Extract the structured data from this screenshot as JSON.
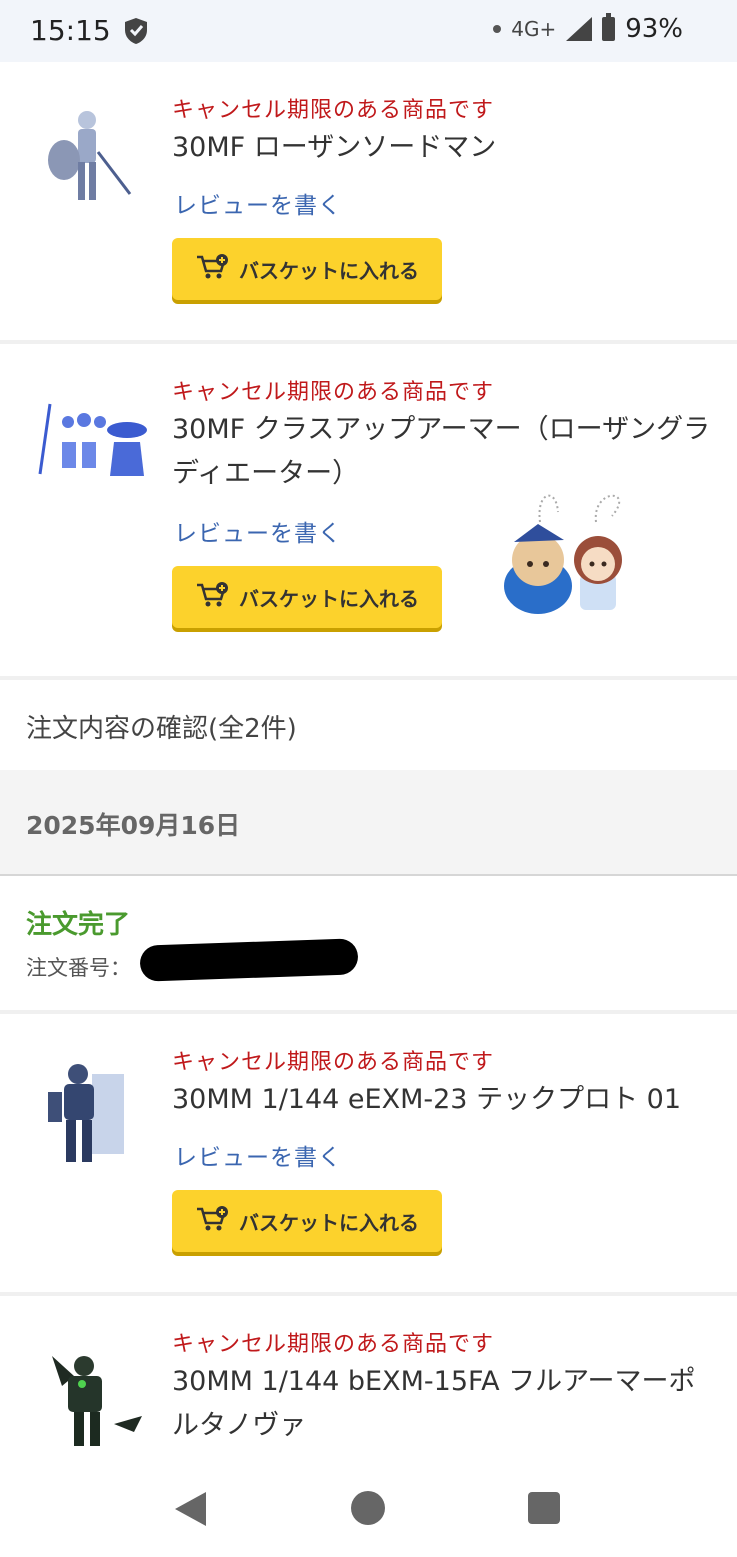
{
  "status_bar": {
    "time": "15:15",
    "network": "4G+",
    "battery": "93%",
    "icons": [
      "shield-icon",
      "dot-icon",
      "signal-icon",
      "battery-icon"
    ]
  },
  "products_top": [
    {
      "warning": "キャンセル期限のある商品です",
      "name": "30MF ローザンソードマン",
      "review": "レビューを書く",
      "basket": "バスケットに入れる"
    },
    {
      "warning": "キャンセル期限のある商品です",
      "name": "30MF クラスアップアーマー（ローザングラディエーター）",
      "review": "レビューを書く",
      "basket": "バスケットに入れる"
    }
  ],
  "order_summary": "注文内容の確認(全2件)",
  "order_date": "2025年09月16日",
  "order": {
    "status": "注文完了",
    "number_label": "注文番号："
  },
  "products_bottom": [
    {
      "warning": "キャンセル期限のある商品です",
      "name": "30MM 1/144 eEXM-23 テックプロト 01",
      "review": "レビューを書く",
      "basket": "バスケットに入れる"
    },
    {
      "warning": "キャンセル期限のある商品です",
      "name": "30MM 1/144 bEXM-15FA フルアーマーポルタノヴァ"
    }
  ],
  "colors": {
    "warning_red": "#c0191b",
    "link_blue": "#3b66b0",
    "basket_yellow": "#fcd22c",
    "order_green": "#4a9a2e"
  }
}
